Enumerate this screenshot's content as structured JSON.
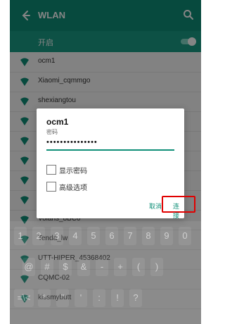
{
  "header": {
    "title": "WLAN"
  },
  "wifi_toggle": {
    "label": "开启"
  },
  "networks": [
    {
      "name": "ocm1"
    },
    {
      "name": "Xiaomi_cqmmgo"
    },
    {
      "name": "shexiangtou"
    },
    {
      "name": ""
    },
    {
      "name": ""
    },
    {
      "name": ""
    },
    {
      "name": ""
    },
    {
      "name": ""
    },
    {
      "name": "Volans_8BC0"
    },
    {
      "name": "Tenda_lw"
    },
    {
      "name": "UTT-HIPER_45368402"
    },
    {
      "name": "CQMC-02"
    },
    {
      "name": "kissmybutt"
    }
  ],
  "dialog": {
    "title": "ocm1",
    "password_label": "密码",
    "password_value": "•••••••••••••••",
    "show_password_label": "显示密码",
    "advanced_label": "高级选项",
    "cancel_label": "取消",
    "connect_label": "连接"
  },
  "keyboard": {
    "row1": [
      "1",
      "2",
      "3",
      "4",
      "5",
      "6",
      "7",
      "8",
      "9",
      "0"
    ],
    "row2": [
      "@",
      "#",
      "$",
      "&",
      "-",
      "+",
      "(",
      ")",
      "",
      ""
    ],
    "row3": [
      "=\\<",
      "*",
      "\"",
      "'",
      ":",
      "!",
      "?",
      "",
      ""
    ]
  },
  "colors": {
    "accent": "#0f8f78",
    "highlight": "#e00000"
  },
  "icons": {
    "back": "back-icon",
    "search": "search-icon",
    "wifi": "wifi-icon"
  }
}
